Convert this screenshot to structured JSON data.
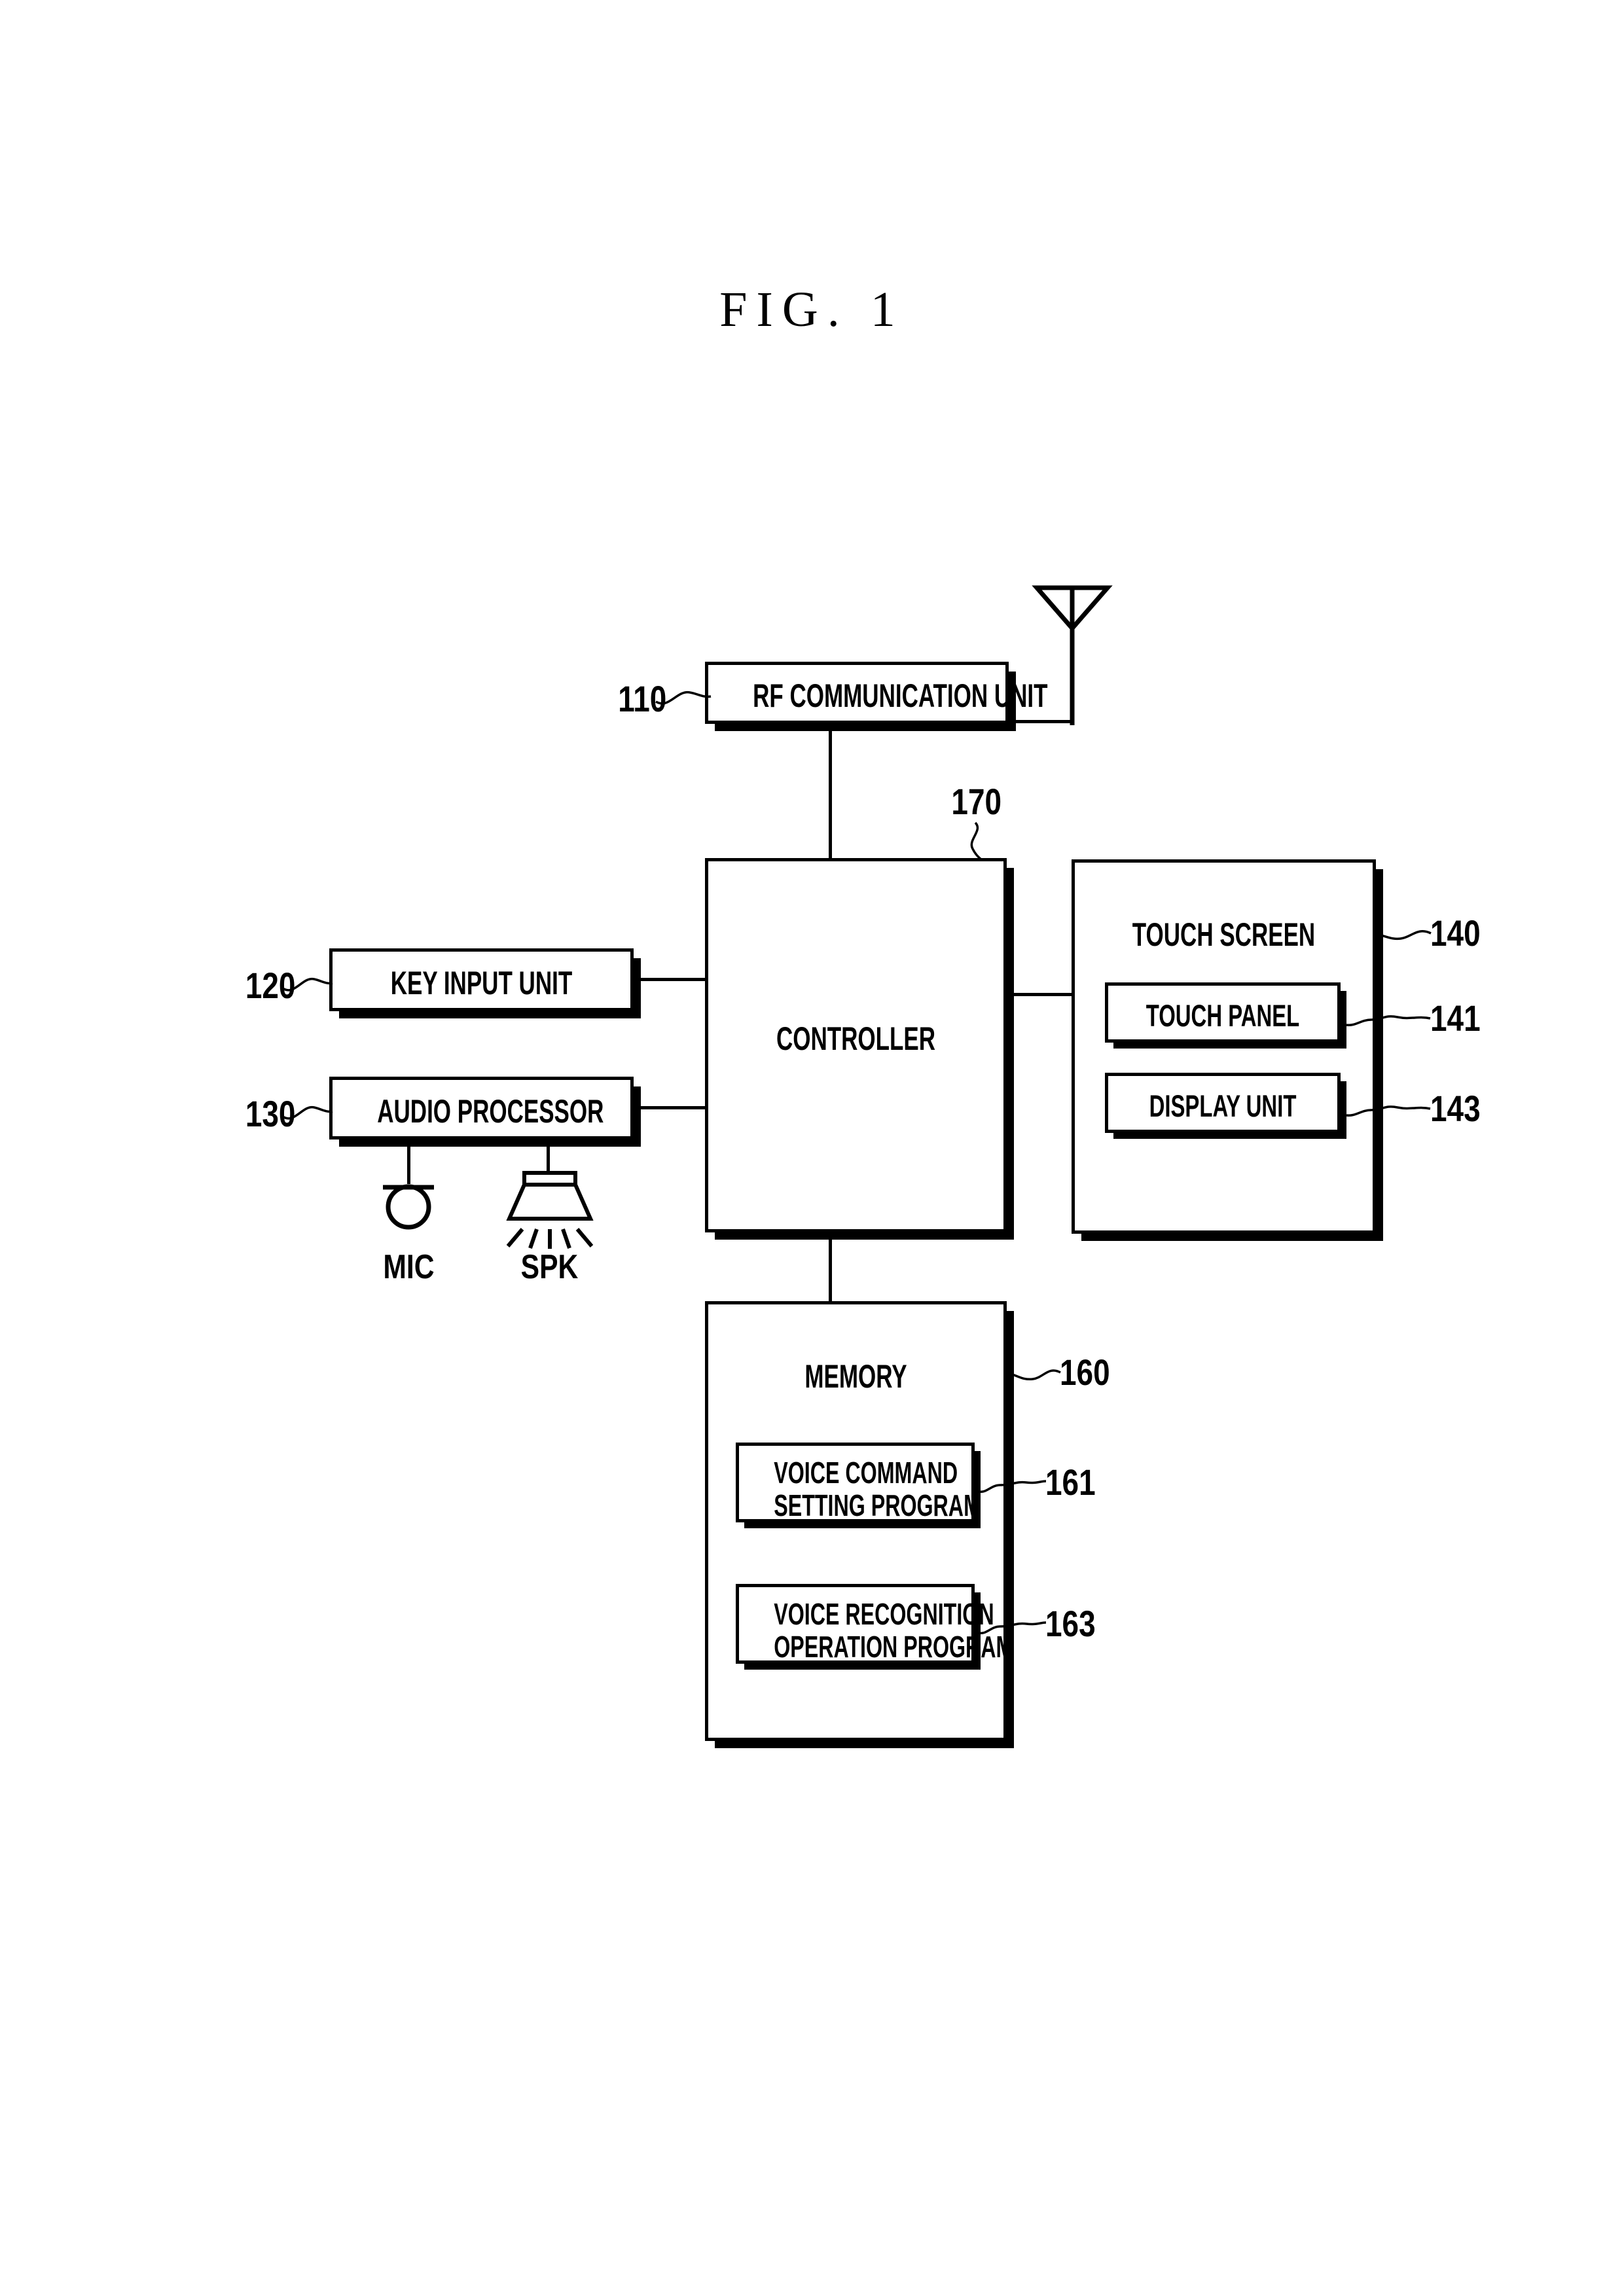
{
  "figure": {
    "title": "FIG. 1",
    "type": "patent-block-diagram"
  },
  "blocks": {
    "rf_communication_unit": {
      "label": "RF COMMUNICATION UNIT",
      "ref": "110"
    },
    "key_input_unit": {
      "label": "KEY INPUT UNIT",
      "ref": "120"
    },
    "audio_processor": {
      "label": "AUDIO PROCESSOR",
      "ref": "130"
    },
    "controller": {
      "label": "CONTROLLER",
      "ref": "170"
    },
    "touch_screen": {
      "label": "TOUCH SCREEN",
      "ref": "140"
    },
    "touch_panel": {
      "label": "TOUCH PANEL",
      "ref": "141"
    },
    "display_unit": {
      "label": "DISPLAY UNIT",
      "ref": "143"
    },
    "memory": {
      "label": "MEMORY",
      "ref": "160"
    },
    "voice_command_setting_program": {
      "label_line1": "VOICE COMMAND",
      "label_line2": "SETTING PROGRAM",
      "ref": "161"
    },
    "voice_recognition_operation_program": {
      "label_line1": "VOICE RECOGNITION",
      "label_line2": "OPERATION PROGRAM",
      "ref": "163"
    }
  },
  "peripherals": {
    "mic": {
      "label": "MIC",
      "icon": "microphone-icon"
    },
    "spk": {
      "label": "SPK",
      "icon": "speaker-icon"
    },
    "antenna": {
      "icon": "antenna-icon"
    }
  },
  "colors": {
    "stroke": "#000000",
    "background": "#ffffff"
  }
}
